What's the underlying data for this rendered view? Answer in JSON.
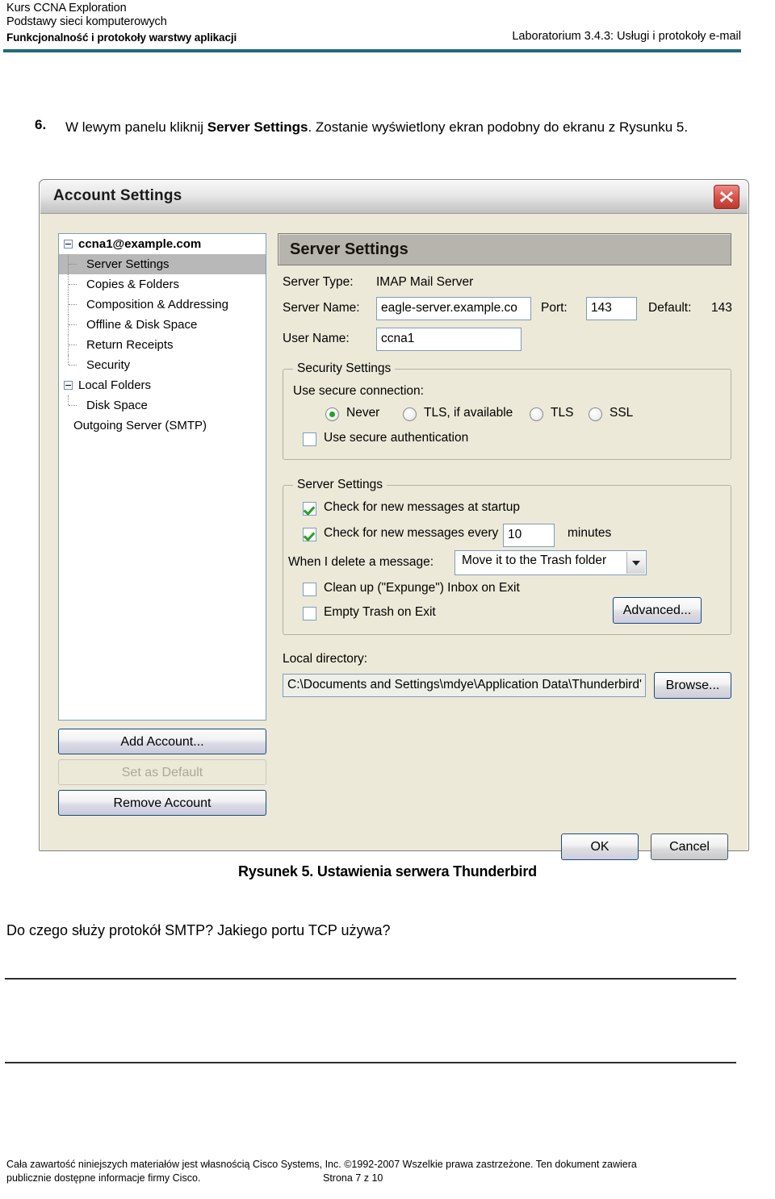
{
  "header": {
    "line1": "Kurs CCNA Exploration",
    "line2": "Podstawy sieci komputerowych",
    "line3": "Funkcjonalność i protokoły warstwy aplikacji",
    "right": "Laboratorium 3.4.3: Usługi i protokoły e-mail",
    "rule_color": "#1f6b78"
  },
  "instruction": {
    "number": "6.",
    "part1": "W lewym panelu kliknij ",
    "bold": "Server Settings",
    "part2": ". Zostanie wyświetlony ekran podobny do ekranu z Rysunku 5."
  },
  "dialog": {
    "title": "Account Settings",
    "close_icon": "close-icon",
    "tree": [
      {
        "label": "ccna1@example.com",
        "level": "root",
        "expander": true,
        "selected": false
      },
      {
        "label": "Server Settings",
        "level": "child",
        "expander": false,
        "selected": true
      },
      {
        "label": "Copies & Folders",
        "level": "child",
        "expander": false,
        "selected": false
      },
      {
        "label": "Composition & Addressing",
        "level": "child",
        "expander": false,
        "selected": false
      },
      {
        "label": "Offline & Disk Space",
        "level": "child",
        "expander": false,
        "selected": false
      },
      {
        "label": "Return Receipts",
        "level": "child",
        "expander": false,
        "selected": false
      },
      {
        "label": "Security",
        "level": "child",
        "expander": false,
        "selected": false
      },
      {
        "label": "Local Folders",
        "level": "root2",
        "expander": true,
        "selected": false
      },
      {
        "label": "Disk Space",
        "level": "child",
        "expander": false,
        "selected": false
      },
      {
        "label": "Outgoing Server (SMTP)",
        "level": "plain",
        "expander": false,
        "selected": false
      }
    ],
    "side_buttons": {
      "add_account": "Add Account...",
      "set_as_default": "Set as Default",
      "remove_account": "Remove Account"
    },
    "pane_title": "Server Settings",
    "fields": {
      "server_type_label": "Server Type:",
      "server_type_value": "IMAP Mail Server",
      "server_name_label": "Server Name:",
      "server_name_value": "eagle-server.example.co",
      "port_label": "Port:",
      "port_value": "143",
      "default_label": "Default:",
      "default_value": "143",
      "user_name_label": "User Name:",
      "user_name_value": "ccna1"
    },
    "security_group": {
      "title": "Security Settings",
      "use_secure_connection_label": "Use secure connection:",
      "options": [
        {
          "label": "Never",
          "selected": true
        },
        {
          "label": "TLS, if available",
          "selected": false
        },
        {
          "label": "TLS",
          "selected": false
        },
        {
          "label": "SSL",
          "selected": false
        }
      ],
      "use_secure_auth_label": "Use secure authentication",
      "use_secure_auth_checked": false
    },
    "server_group": {
      "title": "Server Settings",
      "check_startup_label": "Check for new messages at startup",
      "check_startup_checked": true,
      "check_every_label": "Check for new messages every",
      "check_every_checked": true,
      "check_every_value": "10",
      "minutes_label": "minutes",
      "when_delete_label": "When I delete a message:",
      "when_delete_value": "Move it to the Trash folder",
      "cleanup_label": "Clean up (\"Expunge\") Inbox on Exit",
      "cleanup_checked": false,
      "empty_trash_label": "Empty Trash on Exit",
      "empty_trash_checked": false,
      "advanced_button": "Advanced..."
    },
    "local_directory": {
      "label": "Local directory:",
      "value": "C:\\Documents and Settings\\mdye\\Application Data\\Thunderbird'",
      "browse_button": "Browse..."
    },
    "ok_button": "OK",
    "cancel_button": "Cancel"
  },
  "caption": "Rysunek 5. Ustawienia serwera Thunderbird",
  "question": "Do czego służy protokół SMTP? Jakiego portu TCP używa?",
  "footer": {
    "line1": "Cała zawartość niniejszych materiałów jest własnością Cisco Systems, Inc. ©1992-2007 Wszelkie prawa zastrzeżone. Ten dokument zawiera",
    "line2": "publicznie dostępne informacje firmy Cisco.",
    "page": "Strona 7  z 10"
  }
}
